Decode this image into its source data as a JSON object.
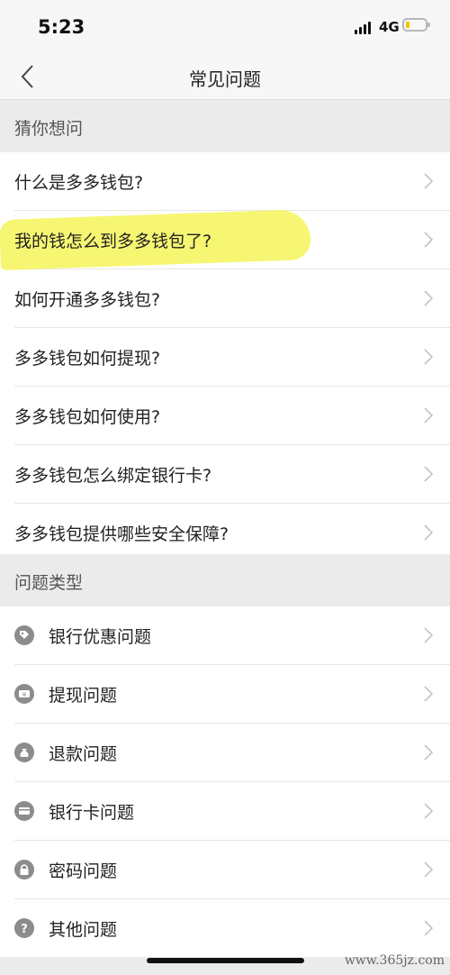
{
  "status": {
    "time": "5:23",
    "network": "4G",
    "battery_color": "#f5c400"
  },
  "nav": {
    "title": "常见问题"
  },
  "guess": {
    "header": "猜你想问",
    "items": [
      "什么是多多钱包?",
      "我的钱怎么到多多钱包了?",
      "如何开通多多钱包?",
      "多多钱包如何提现?",
      "多多钱包如何使用?",
      "多多钱包怎么绑定银行卡?",
      "多多钱包提供哪些安全保障?"
    ]
  },
  "types": {
    "header": "问题类型",
    "items": [
      {
        "label": "银行优惠问题",
        "icon": "tag-icon"
      },
      {
        "label": "提现问题",
        "icon": "ticket-icon"
      },
      {
        "label": "退款问题",
        "icon": "money-bag-icon"
      },
      {
        "label": "银行卡问题",
        "icon": "card-icon"
      },
      {
        "label": "密码问题",
        "icon": "lock-icon"
      },
      {
        "label": "其他问题",
        "icon": "question-icon"
      }
    ]
  },
  "watermark": "www.365jz.com",
  "highlight_color": "#f5f55a"
}
